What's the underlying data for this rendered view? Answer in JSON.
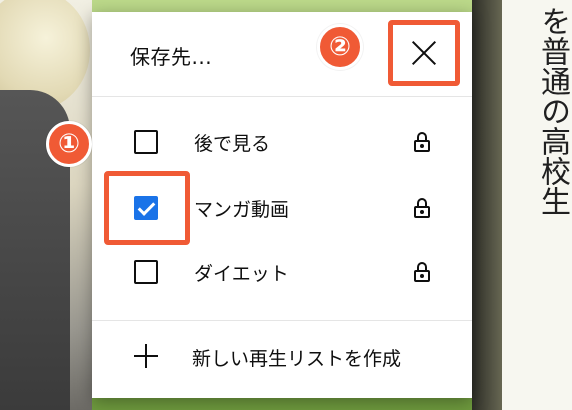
{
  "background": {
    "right_vertical_text": "を普通の高校生"
  },
  "dialog": {
    "title": "保存先...",
    "close_icon": "close-icon",
    "items": [
      {
        "label": "後で見る",
        "checked": false,
        "icon": "lock-icon"
      },
      {
        "label": "マンガ動画",
        "checked": true,
        "icon": "lock-icon"
      },
      {
        "label": "ダイエット",
        "checked": false,
        "icon": "lock-icon"
      }
    ],
    "create_label": "新しい再生リストを作成",
    "create_icon": "plus-icon"
  },
  "annotations": {
    "badge1": "①",
    "badge2": "②",
    "highlight_color": "#f05a35"
  },
  "colors": {
    "accent": "#1a73e8",
    "annotation": "#f05a35"
  }
}
